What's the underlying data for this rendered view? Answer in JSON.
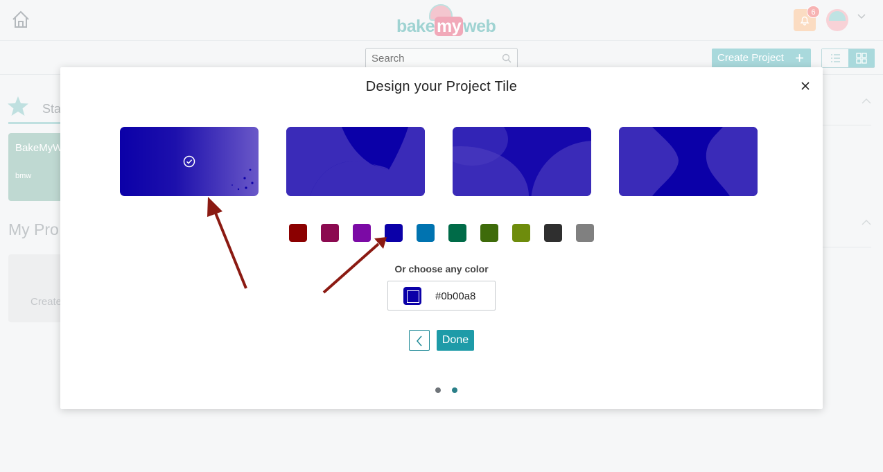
{
  "header": {
    "logo": {
      "part1": "bake",
      "part2": "my",
      "part3": "web"
    },
    "notifications_count": "6"
  },
  "toolbar": {
    "search_placeholder": "Search",
    "create_project_label": "Create Project"
  },
  "background": {
    "starred_tab_label": "Sta",
    "project_card_title": "BakeMyW",
    "project_card_subtitle": "bmw",
    "my_projects_heading": "My Pro",
    "create_card_label": "Create"
  },
  "modal": {
    "title": "Design your Project Tile",
    "tile_color": "#0b00a8",
    "selected_tile_index": 0,
    "swatches": [
      "#8b0000",
      "#8b0a50",
      "#7b0aa5",
      "#0b00a8",
      "#0073b0",
      "#006b48",
      "#3e6b0a",
      "#6e8c0c",
      "#2f2f2f",
      "#808080"
    ],
    "custom_color_label": "Or choose any color",
    "custom_color_value": "#0b00a8",
    "done_label": "Done",
    "current_step": 2,
    "total_steps": 2
  },
  "annotation_color": "#8b1a12"
}
